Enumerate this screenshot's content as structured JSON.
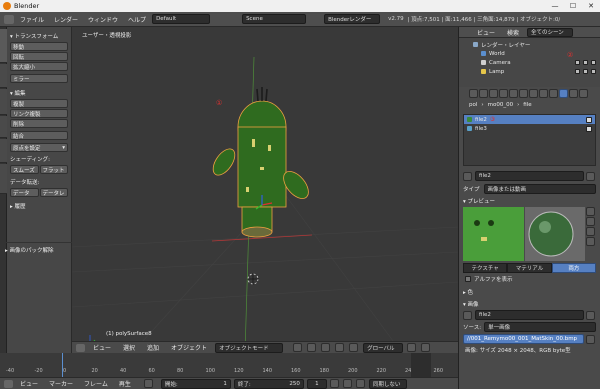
{
  "window": {
    "title": "Blender"
  },
  "menubar": {
    "items": [
      "ファイル",
      "レンダー",
      "ウィンドウ",
      "ヘルプ"
    ],
    "layout_value": "Default",
    "scene_value": "Scene",
    "engine_value": "Blenderレンダー",
    "version": "v2.79",
    "stats": "| 頂点:7,501 | 面:11,466 | 三角面:14,879 | オブジェクト:0/29 | ランプ:0/1"
  },
  "tools": {
    "transform_title": "▾ トランスフォーム",
    "transform_buttons": [
      "移動",
      "回転",
      "拡大縮小",
      "ミラー"
    ],
    "edit_title": "▾ 編集",
    "edit_buttons": [
      "複製",
      "リンク複製",
      "削除",
      "結合"
    ],
    "origin_label": "原点を設定",
    "shading_label": "シェーディング:",
    "smooth_label": "スムーズ",
    "flat_label": "フラット",
    "data_transfer_label": "データ転送:",
    "data_label": "データ",
    "data_layers_label": "データレ",
    "history_label": "▸ 履歴",
    "pack_label": "▸ 画像のパック解除"
  },
  "viewport": {
    "view_label": "ユーザー・透視投影",
    "object_label": "(1) polySurface8",
    "annotations": {
      "one": "①",
      "two": "②",
      "three": "③"
    }
  },
  "viewport_header": {
    "items": [
      "ビュー",
      "選択",
      "追加",
      "オブジェクト"
    ],
    "mode_value": "オブジェクトモード",
    "orientation_value": "グローバル"
  },
  "timeline": {
    "ruler_ticks": [
      "-40",
      "-20",
      "0",
      "20",
      "40",
      "60",
      "80",
      "100",
      "120",
      "140",
      "160",
      "180",
      "200",
      "220",
      "240",
      "260"
    ],
    "items": [
      "ビュー",
      "マーカー",
      "フレーム",
      "再生"
    ],
    "start_label": "開始:",
    "start_value": "1",
    "end_label": "終了:",
    "end_value": "250",
    "current_frame": "1",
    "sync_value": "同期しない"
  },
  "outliner": {
    "header_items": [
      "ビュー",
      "検索"
    ],
    "filter_value": "全てのシーン",
    "rows": [
      {
        "label": "レンダー・レイヤー",
        "icon_color": "#8aa8c8"
      },
      {
        "label": "World",
        "icon_color": "#5b8fcf"
      },
      {
        "label": "Camera",
        "icon_color": "#cfcfcf"
      },
      {
        "label": "Lamp",
        "icon_color": "#e6c64a"
      }
    ]
  },
  "properties": {
    "breadcrumb": [
      "pol",
      "mo00_00",
      "file"
    ],
    "texture_slots": [
      "file2",
      "file3"
    ],
    "texture_name": "file2",
    "type_label": "タイプ",
    "type_value": "画像または動画",
    "preview_title": "▾ プレビュー",
    "preview_tabs": [
      "テクスチャ",
      "マテリアル",
      "両方"
    ],
    "alpha_label": "アルファを表示",
    "color_section": "▸ 色",
    "image_section": "▾ 画像",
    "image_name": "file2",
    "source_label": "ソース:",
    "source_value": "単一画像",
    "filepath_value": "//001_Remymo00_001_MatSkin_00.bmp",
    "image_info": "画像: サイズ 2048 × 2048、RGB byte型"
  },
  "colors": {
    "accent": "#5680c2",
    "selection_orange": "#f0a040",
    "annotation_red": "#e03030",
    "object_green": "#2f6b1f"
  }
}
